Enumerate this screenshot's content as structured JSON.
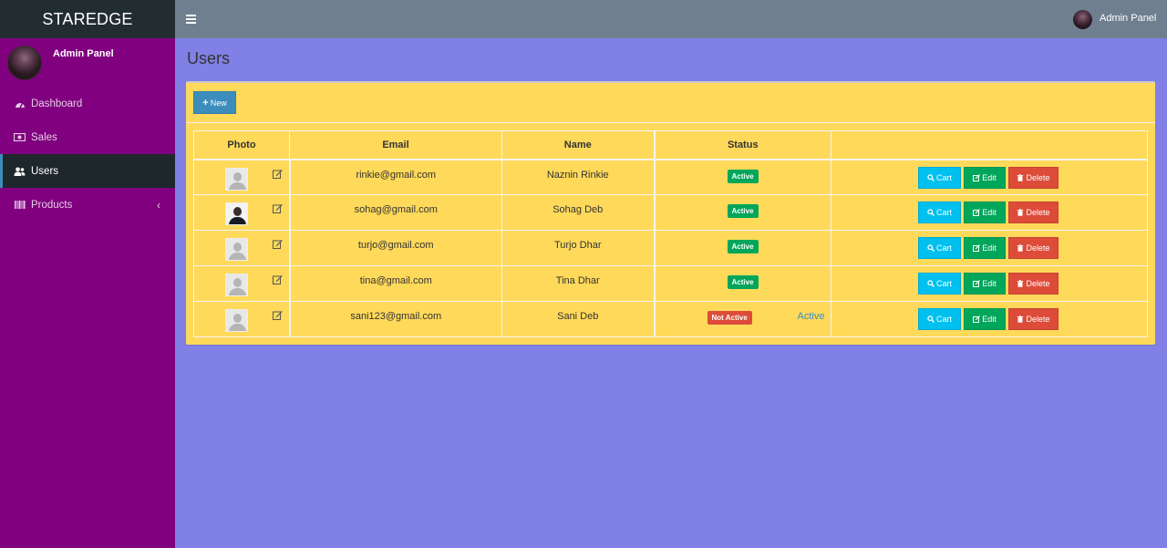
{
  "brand": "STAREDGE",
  "sidebar": {
    "user_name": "Admin Panel",
    "items": [
      {
        "label": "Dashboard",
        "icon": "dashboard-icon"
      },
      {
        "label": "Sales",
        "icon": "money-icon"
      },
      {
        "label": "Users",
        "icon": "users-icon",
        "active": true
      },
      {
        "label": "Products",
        "icon": "barcode-icon",
        "has_children": true
      }
    ]
  },
  "topbar": {
    "user_name": "Admin Panel"
  },
  "page": {
    "title": "Users",
    "new_button": "New",
    "table": {
      "headers": [
        "Photo",
        "Email",
        "Name",
        "Status",
        ""
      ],
      "rows": [
        {
          "email": "rinkie@gmail.com",
          "name": "Naznin Rinkie",
          "status": "Active",
          "photo": "placeholder"
        },
        {
          "email": "sohag@gmail.com",
          "name": "Sohag Deb",
          "status": "Active",
          "photo": "person"
        },
        {
          "email": "turjo@gmail.com",
          "name": "Turjo Dhar",
          "status": "Active",
          "photo": "placeholder"
        },
        {
          "email": "tina@gmail.com",
          "name": "Tina Dhar",
          "status": "Active",
          "photo": "placeholder"
        },
        {
          "email": "sani123@gmail.com",
          "name": "Sani Deb",
          "status": "Not Active",
          "status_link": "Active",
          "photo": "placeholder"
        }
      ],
      "actions": {
        "cart": "Cart",
        "edit": "Edit",
        "delete": "Delete"
      }
    }
  },
  "colors": {
    "sidebar_bg": "#800080",
    "topbar_bg": "#6f7f8f",
    "content_bg": "#8080e6",
    "box_bg": "#ffd95a",
    "active_label": "#00a65a",
    "inactive_label": "#dd4b39",
    "cart_button": "#00c0ef",
    "edit_button": "#00a65a",
    "delete_button": "#dd4b39",
    "new_button": "#3c8dbc"
  }
}
